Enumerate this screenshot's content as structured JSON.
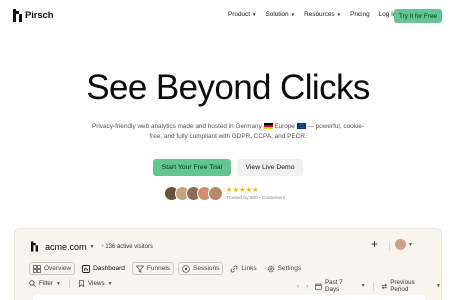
{
  "nav": {
    "brand": "Pirsch",
    "items": [
      {
        "label": "Product",
        "has_caret": true
      },
      {
        "label": "Solution",
        "has_caret": true
      },
      {
        "label": "Resources",
        "has_caret": true
      },
      {
        "label": "Pricing",
        "has_caret": false
      },
      {
        "label": "Log In",
        "has_caret": false
      }
    ],
    "cta": "Try It for Free"
  },
  "hero": {
    "title": "See Beyond Clicks",
    "subtitle_part1": "Privacy-friendly web analytics made and hosted in Germany",
    "subtitle_part2": "Europe",
    "subtitle_part3": "— powerful, cookie-free, and fully compliant with GDPR, CCPA, and PECR.",
    "primary_button": "Start Your Free Trial",
    "secondary_button": "View Live Demo",
    "stars": "★★★★★",
    "trusted": "Trusted by 500+ Customers"
  },
  "dashboard": {
    "domain": "acme.com",
    "active_visitors": "136 active visitors",
    "tabs": [
      {
        "label": "Overview",
        "icon": "overview-grid-icon"
      },
      {
        "label": "Dashboard",
        "icon": "dashboard-icon"
      },
      {
        "label": "Funnels",
        "icon": "funnel-icon"
      },
      {
        "label": "Sessions",
        "icon": "sessions-icon"
      },
      {
        "label": "Links",
        "icon": "link-icon"
      },
      {
        "label": "Settings",
        "icon": "gear-icon"
      }
    ],
    "filter": "Filter",
    "views": "Views",
    "period": "Past 7 Days",
    "compare": "Previous Period"
  },
  "colors": {
    "accent": "#63c58f",
    "dash_bg": "#f7f5ee",
    "star": "#f4b400",
    "flag_de": [
      "#000000",
      "#dd0000",
      "#ffce00"
    ],
    "flag_eu": "#003399"
  }
}
